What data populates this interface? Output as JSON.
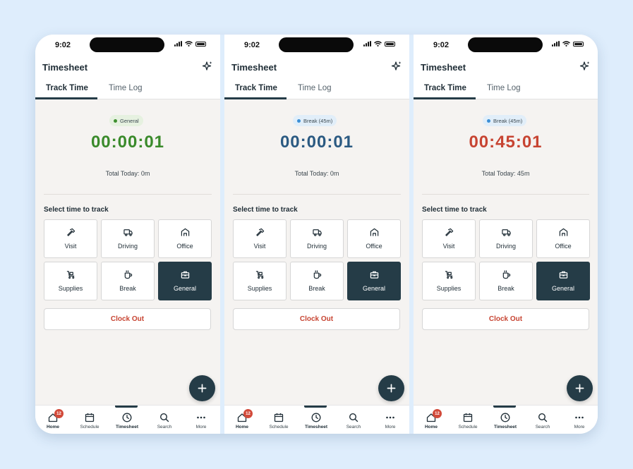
{
  "status_bar": {
    "time": "9:02"
  },
  "header": {
    "title": "Timesheet"
  },
  "tabs": [
    {
      "label": "Track Time",
      "active": true
    },
    {
      "label": "Time Log",
      "active": false
    }
  ],
  "select_label": "Select time to track",
  "options": [
    {
      "label": "Visit",
      "icon": "hammer-icon"
    },
    {
      "label": "Driving",
      "icon": "truck-icon"
    },
    {
      "label": "Office",
      "icon": "building-icon"
    },
    {
      "label": "Supplies",
      "icon": "cart-icon"
    },
    {
      "label": "Break",
      "icon": "coffee-cup-icon"
    },
    {
      "label": "General",
      "icon": "briefcase-icon",
      "selected": true
    }
  ],
  "clock_out_label": "Clock Out",
  "nav": {
    "home": "Home",
    "home_badge": "12",
    "schedule": "Schedule",
    "timesheet": "Timesheet",
    "search": "Search",
    "more": "More"
  },
  "colors": {
    "accent": "#253c47",
    "green": "#3a8a2b",
    "blue": "#2b5a82",
    "red": "#c74432",
    "badge_red": "#d24a3a"
  },
  "screens": [
    {
      "status_badge": "General",
      "status_badge_dot": "#3f8f2f",
      "status_badge_bg": "#e6f1e0",
      "timer": "00:00:01",
      "timer_color": "#3a8a2b",
      "total_today": "Total Today: 0m"
    },
    {
      "status_badge": "Break (45m)",
      "status_badge_dot": "#3c8fd6",
      "status_badge_bg": "#e1eef9",
      "timer": "00:00:01",
      "timer_color": "#2b5a82",
      "total_today": "Total Today: 0m"
    },
    {
      "status_badge": "Break (45m)",
      "status_badge_dot": "#3c8fd6",
      "status_badge_bg": "#e1eef9",
      "timer": "00:45:01",
      "timer_color": "#c74432",
      "total_today": "Total Today: 45m"
    }
  ]
}
